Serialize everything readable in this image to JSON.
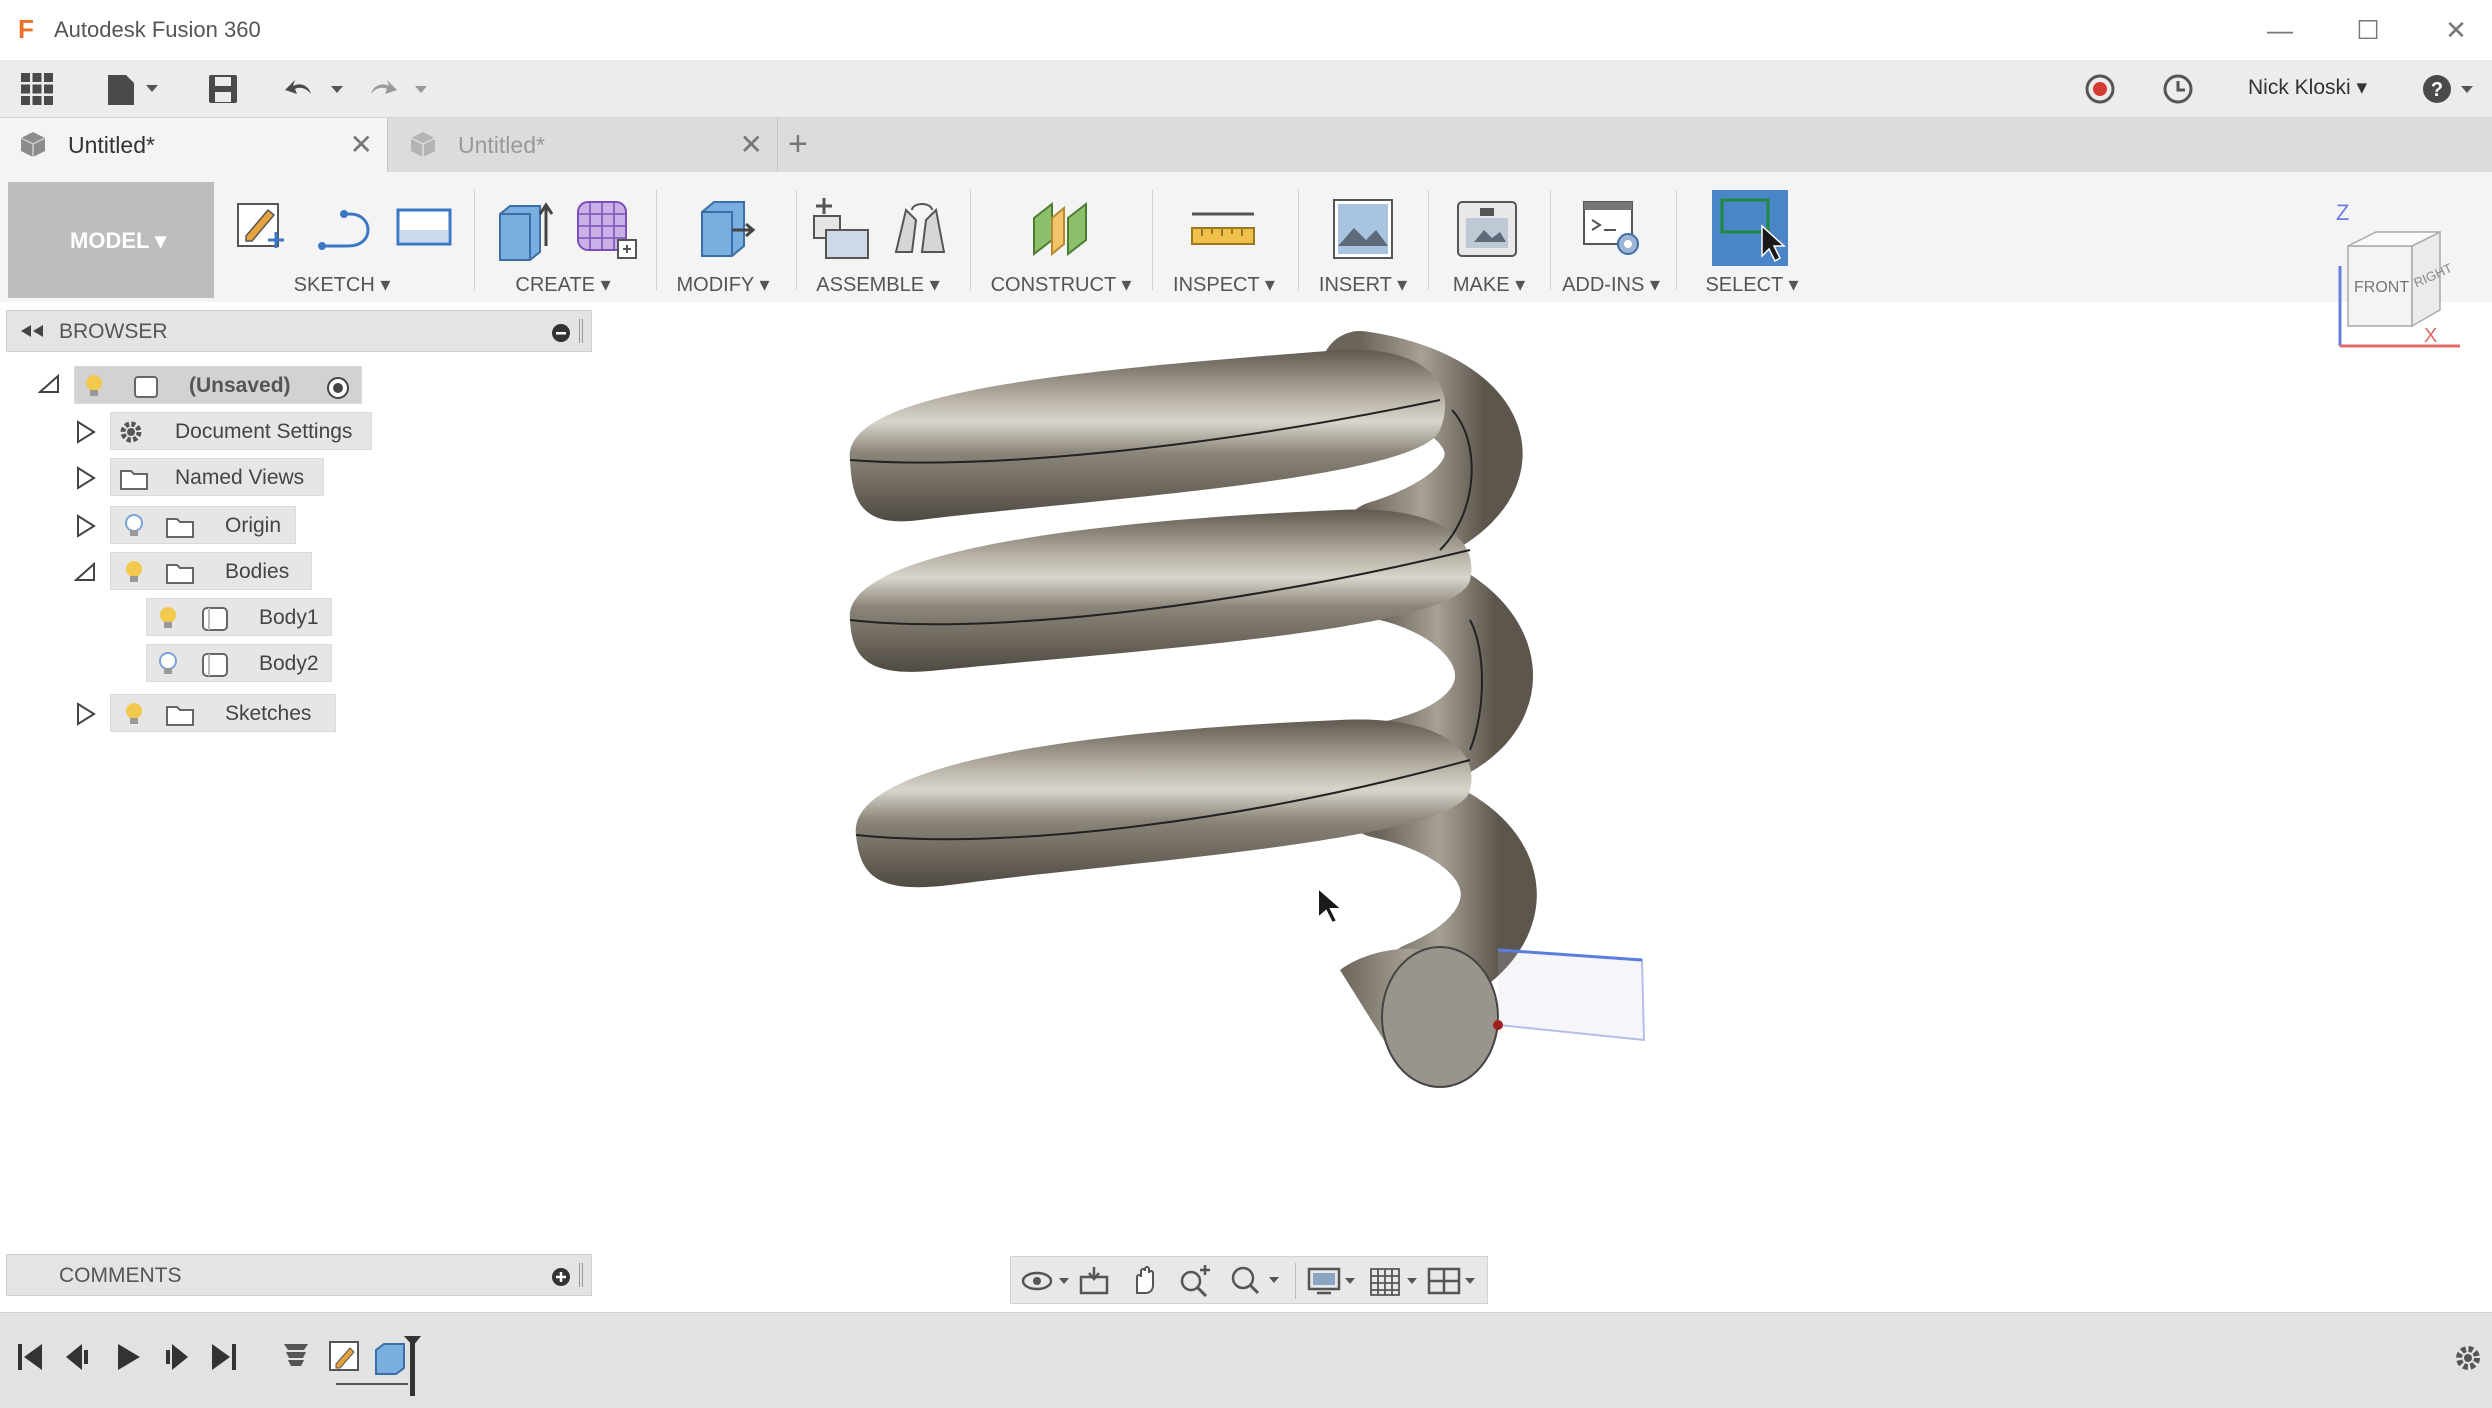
{
  "window": {
    "title": "Autodesk Fusion 360",
    "app_logo": "F",
    "controls": [
      "minimize-icon",
      "maximize-icon",
      "close-icon"
    ]
  },
  "quick_access": {
    "icons": [
      "app-grid-icon",
      "file-menu-icon",
      "save-icon",
      "undo-icon",
      "redo-icon"
    ],
    "right_icons": [
      "record-icon",
      "history-clock-icon",
      "help-icon"
    ],
    "user": "Nick Kloski ▾"
  },
  "tabs": [
    {
      "label": "Untitled*",
      "active": true
    },
    {
      "label": "Untitled*",
      "active": false
    }
  ],
  "new_tab_label": "+",
  "toolbar": {
    "workspace": "MODEL ▾",
    "groups": [
      {
        "label": "SKETCH ▾"
      },
      {
        "label": "CREATE ▾"
      },
      {
        "label": "MODIFY ▾"
      },
      {
        "label": "ASSEMBLE ▾"
      },
      {
        "label": "CONSTRUCT ▾"
      },
      {
        "label": "INSPECT ▾"
      },
      {
        "label": "INSERT ▾"
      },
      {
        "label": "MAKE ▾"
      },
      {
        "label": "ADD-INS ▾"
      },
      {
        "label": "SELECT ▾"
      }
    ]
  },
  "browser": {
    "title": "BROWSER",
    "root": "(Unsaved)",
    "items": [
      {
        "label": "Document Settings"
      },
      {
        "label": "Named Views"
      },
      {
        "label": "Origin"
      },
      {
        "label": "Bodies"
      },
      {
        "label": "Body1"
      },
      {
        "label": "Body2"
      },
      {
        "label": "Sketches"
      }
    ]
  },
  "viewcube": {
    "front": "FRONT",
    "right": "RIGHT",
    "axis_z": "Z",
    "axis_x": "X"
  },
  "comments": {
    "title": "COMMENTS"
  },
  "colors": {
    "accent_select": "#4a86c7",
    "model_btn": "#bdbdbd",
    "coil": "#8a8377"
  }
}
